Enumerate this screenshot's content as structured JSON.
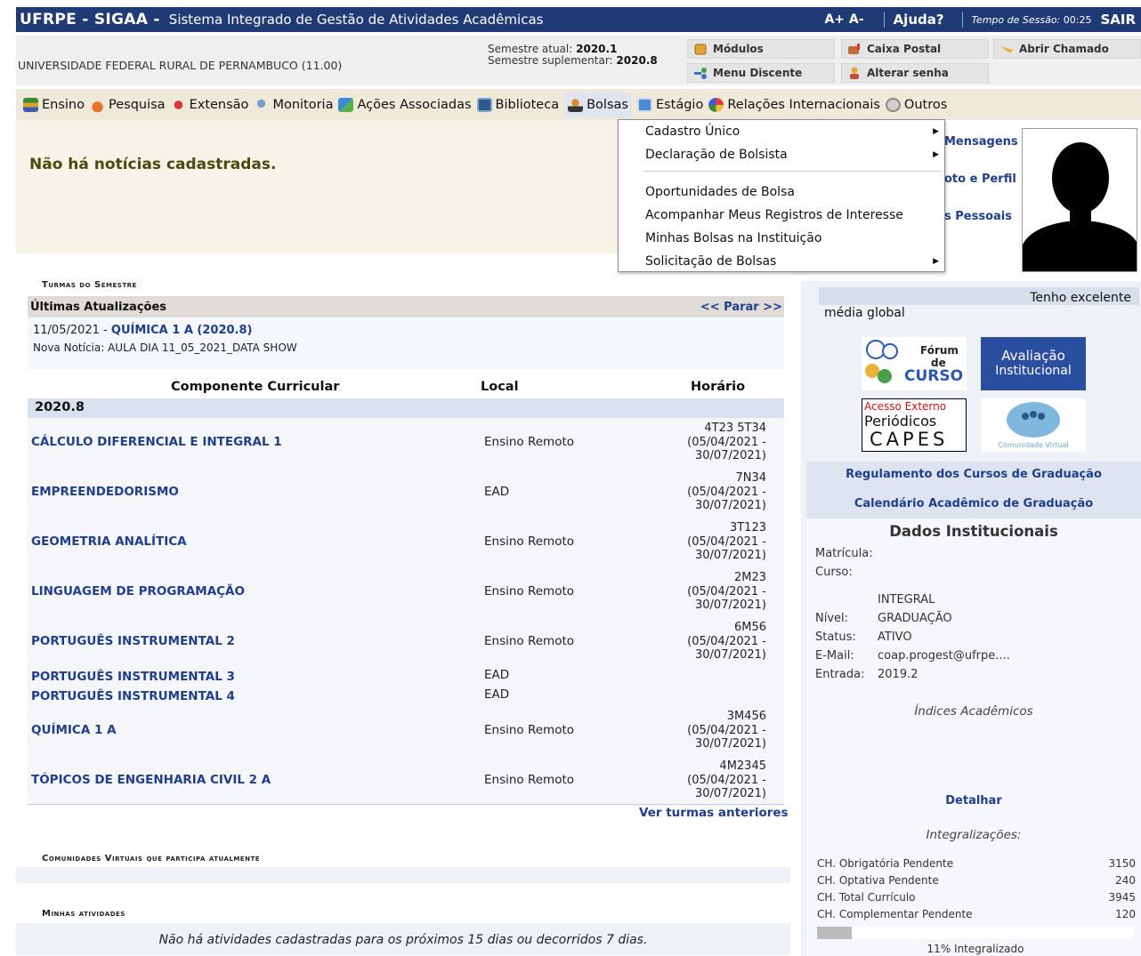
{
  "topbar": {
    "brand": "UFRPE - SIGAA -",
    "system_name": "Sistema Integrado de Gestão de Atividades Acadêmicas",
    "font_increase": "A+",
    "font_decrease": "A-",
    "help": "Ajuda?",
    "session_label": "Tempo de Sessão:",
    "session_time": "00:25",
    "exit": "SAIR"
  },
  "info": {
    "university": "UNIVERSIDADE FEDERAL RURAL DE PERNAMBUCO (11.00)",
    "semester_label": "Semestre atual:",
    "semester": "2020.1",
    "supp_semester_label": "Semestre suplementar:",
    "supp_semester": "2020.8",
    "quick": {
      "modulos": "Módulos",
      "caixa_postal": "Caixa Postal",
      "abrir_chamado": "Abrir Chamado",
      "menu_discente": "Menu Discente",
      "alterar_senha": "Alterar senha"
    }
  },
  "menu": {
    "ensino": "Ensino",
    "pesquisa": "Pesquisa",
    "extensao": "Extensão",
    "monitoria": "Monitoria",
    "acoes": "Ações Associadas",
    "biblioteca": "Biblioteca",
    "bolsas": "Bolsas",
    "estagio": "Estágio",
    "relacoes": "Relações Internacionais",
    "outros": "Outros"
  },
  "dropdown": {
    "items": [
      "Cadastro Único",
      "Declaração de Bolsista",
      "Oportunidades de Bolsa",
      "Acompanhar Meus Registros de Interesse",
      "Minhas Bolsas na Instituição",
      "Solicitação de Bolsas"
    ]
  },
  "news": {
    "message": "Não há notícias cadastradas."
  },
  "profile": {
    "link_mensagens": "Mensagens",
    "link_foto_perfil": "oto e Perfil",
    "link_dados": "s Pessoais"
  },
  "sections": {
    "turmas": "Turmas do Semestre",
    "comunidades": "Comunidades Virtuais que participa atualmente",
    "atividades": "Minhas atividades"
  },
  "updates": {
    "title": "Últimas Atualizações",
    "pager": "<< Parar >>",
    "date": "11/05/2021 -",
    "course": "QUÍMICA 1 A (2020.8)",
    "news": "Nova Notícia: AULA DIA 11_05_2021_DATA SHOW"
  },
  "table": {
    "headers": [
      "Componente Curricular",
      "Local",
      "Horário"
    ],
    "semester": "2020.8",
    "rows": [
      {
        "name": "CÁLCULO DIFERENCIAL E INTEGRAL 1",
        "local": "Ensino Remoto",
        "h1": "4T23 5T34",
        "h2": "(05/04/2021 -",
        "h3": "30/07/2021)"
      },
      {
        "name": "EMPREENDEDORISMO",
        "local": "EAD",
        "h1": "7N34",
        "h2": "(05/04/2021 -",
        "h3": "30/07/2021)"
      },
      {
        "name": "GEOMETRIA ANALÍTICA",
        "local": "Ensino Remoto",
        "h1": "3T123",
        "h2": "(05/04/2021 -",
        "h3": "30/07/2021)"
      },
      {
        "name": "LINGUAGEM DE PROGRAMAÇÃO",
        "local": "Ensino Remoto",
        "h1": "2M23",
        "h2": "(05/04/2021 -",
        "h3": "30/07/2021)"
      },
      {
        "name": "PORTUGUÊS INSTRUMENTAL 2",
        "local": "Ensino Remoto",
        "h1": "6M56",
        "h2": "(05/04/2021 -",
        "h3": "30/07/2021)"
      },
      {
        "name": "PORTUGUÊS INSTRUMENTAL 3",
        "local": "EAD",
        "h1": "",
        "h2": "",
        "h3": ""
      },
      {
        "name": "PORTUGUÊS INSTRUMENTAL 4",
        "local": "EAD",
        "h1": "",
        "h2": "",
        "h3": ""
      },
      {
        "name": "QUÍMICA 1 A",
        "local": "Ensino Remoto",
        "h1": "3M456",
        "h2": "(05/04/2021 -",
        "h3": "30/07/2021)"
      },
      {
        "name": "TÓPICOS DE ENGENHARIA CIVIL 2 A",
        "local": "Ensino Remoto",
        "h1": "4M2345",
        "h2": "(05/04/2021 -",
        "h3": "30/07/2021)"
      }
    ],
    "see_previous": "Ver turmas anteriores"
  },
  "activities": {
    "empty": "Não há atividades cadastradas para os próximos 15 dias ou decorridos 7 dias."
  },
  "status": {
    "line1": "Tenho excelente",
    "line2": "média global"
  },
  "logos": {
    "forum_line1": "Fórum",
    "forum_line2": "de",
    "forum_line3": "CURSO",
    "avaliacao_line1": "Avaliação",
    "avaliacao_line2": "Institucional",
    "capes_line1": "Acesso Externo",
    "capes_line2": "Periódicos",
    "capes_line3": "CAPES",
    "comunidade": "Comunidade Virtual"
  },
  "links": {
    "regulamento": "Regulamento dos Cursos de Graduação",
    "calendario": "Calendário Acadêmico de Graduação"
  },
  "dados": {
    "title": "Dados Institucionais",
    "matricula_label": "Matrícula:",
    "curso_label": "Curso:",
    "curso_value": "INTEGRAL",
    "nivel_label": "Nível:",
    "nivel_value": "GRADUAÇÃO",
    "status_label": "Status:",
    "status_value": "ATIVO",
    "email_label": "E-Mail:",
    "email_value": "coap.progest@ufrpe....",
    "entrada_label": "Entrada:",
    "entrada_value": "2019.2",
    "indices": "Índices Acadêmicos",
    "detalhar": "Detalhar",
    "integralizacoes": "Integralizações:",
    "ch": [
      {
        "label": "CH. Obrigatória Pendente",
        "value": "3150"
      },
      {
        "label": "CH. Optativa Pendente",
        "value": "240"
      },
      {
        "label": "CH. Total Currículo",
        "value": "3945"
      },
      {
        "label": "CH. Complementar Pendente",
        "value": "120"
      }
    ],
    "progress_fraction": 0.11,
    "progress_text": "11% Integralizado"
  }
}
